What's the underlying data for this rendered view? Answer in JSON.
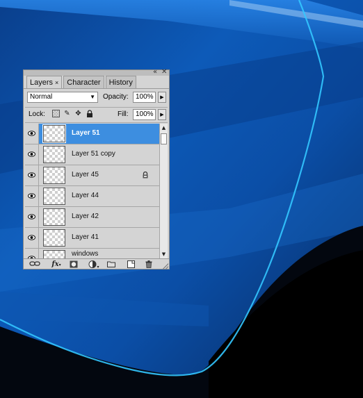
{
  "colors": {
    "accent": "#3d8ee0",
    "panel_bg": "#d4d4d4"
  },
  "panel": {
    "window_buttons": {
      "collapse": "«",
      "close": "✕"
    },
    "tabs": [
      {
        "label": "Layers",
        "active": true,
        "close": "×"
      },
      {
        "label": "Character",
        "active": false
      },
      {
        "label": "History",
        "active": false
      }
    ],
    "blend_mode": "Normal",
    "opacity_label": "Opacity:",
    "opacity_value": "100%",
    "lock_label": "Lock:",
    "fill_label": "Fill:",
    "fill_value": "100%",
    "lock_icons": [
      "lock-transparent-icon",
      "lock-image-icon",
      "lock-position-icon",
      "lock-all-icon"
    ],
    "layers": [
      {
        "name": "Layer 51",
        "selected": true,
        "visible": true,
        "locked": false
      },
      {
        "name": "Layer 51 copy",
        "selected": false,
        "visible": true,
        "locked": false
      },
      {
        "name": "Layer 45",
        "selected": false,
        "visible": true,
        "locked": true
      },
      {
        "name": "Layer 44",
        "selected": false,
        "visible": true,
        "locked": false
      },
      {
        "name": "Layer 42",
        "selected": false,
        "visible": true,
        "locked": false
      },
      {
        "name": "Layer 41",
        "selected": false,
        "visible": true,
        "locked": false
      },
      {
        "name": "windows",
        "selected": false,
        "visible": true,
        "locked": false
      }
    ],
    "bottom_icons": [
      "link-layers-icon",
      "fx-icon",
      "add-mask-icon",
      "adjustment-layer-icon",
      "new-group-icon",
      "new-layer-icon",
      "trash-icon"
    ]
  }
}
